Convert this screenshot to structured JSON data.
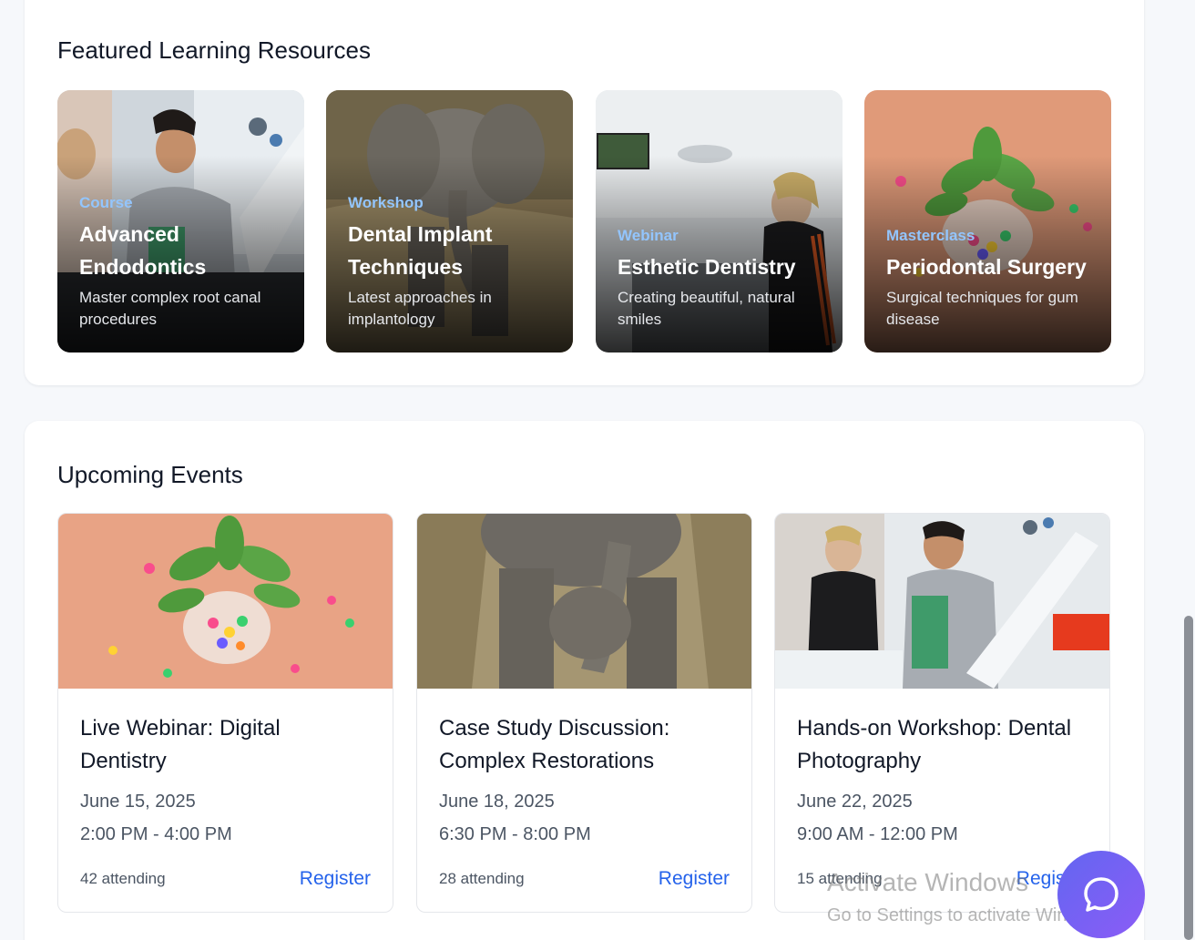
{
  "featured": {
    "title": "Featured Learning Resources",
    "items": [
      {
        "category": "Course",
        "title": "Advanced Endodontics",
        "description": "Master complex root canal procedures",
        "image": "dentist-patient-photo"
      },
      {
        "category": "Workshop",
        "title": "Dental Implant Techniques",
        "description": "Latest approaches in implantology",
        "image": "elephant-photo"
      },
      {
        "category": "Webinar",
        "title": "Esthetic Dentistry",
        "description": "Creating beautiful, natural smiles",
        "image": "dental-clinic-photo"
      },
      {
        "category": "Masterclass",
        "title": "Periodontal Surgery",
        "description": "Surgical techniques for gum disease",
        "image": "plant-bowl-photo"
      }
    ]
  },
  "events": {
    "title": "Upcoming Events",
    "items": [
      {
        "title": "Live Webinar: Digital Dentistry",
        "date": "June 15, 2025",
        "time": "2:00 PM - 4:00 PM",
        "attending": "42 attending",
        "action": "Register",
        "image": "plant-bowl-photo"
      },
      {
        "title": "Case Study Discussion: Complex Restorations",
        "date": "June 18, 2025",
        "time": "6:30 PM - 8:00 PM",
        "attending": "28 attending",
        "action": "Register",
        "image": "elephant-photo"
      },
      {
        "title": "Hands-on Workshop: Dental Photography",
        "date": "June 22, 2025",
        "time": "9:00 AM - 12:00 PM",
        "attending": "15 attending",
        "action": "Register",
        "image": "dentist-patient-photo"
      }
    ]
  },
  "watermark": {
    "line1": "Activate Windows",
    "line2": "Go to Settings to activate Windows."
  },
  "chat": {
    "icon": "chat-bubble-icon"
  },
  "colors": {
    "accent": "#2563eb",
    "category": "#93c5fd",
    "chat_from": "#6366f1",
    "chat_to": "#8b5cf6"
  }
}
